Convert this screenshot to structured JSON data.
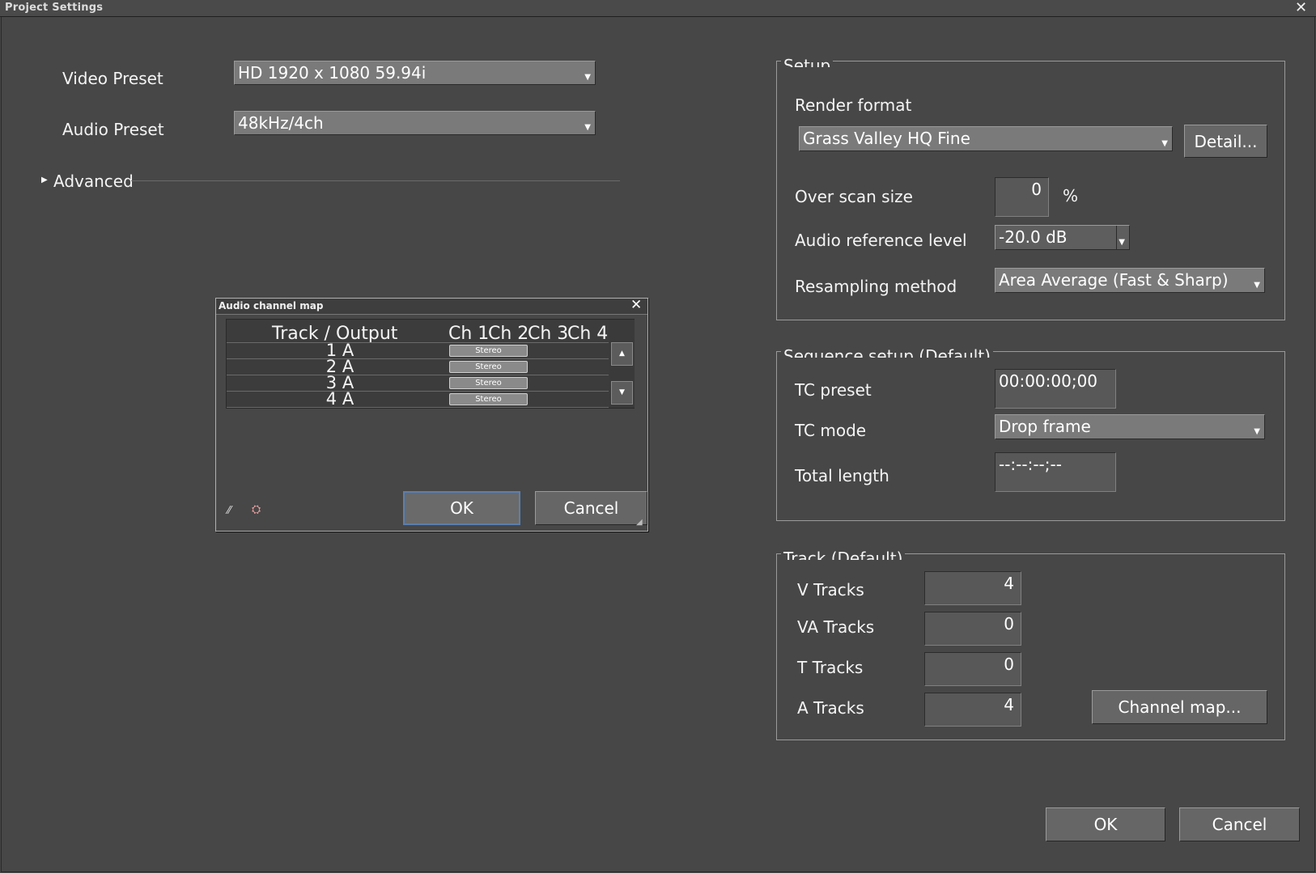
{
  "window": {
    "title": "Project Settings",
    "close_glyph": "✕"
  },
  "left": {
    "video_preset_label": "Video Preset",
    "video_preset_value": "HD 1920 x 1080 59.94i",
    "audio_preset_label": "Audio Preset",
    "audio_preset_value": "48kHz/4ch",
    "advanced_label": "Advanced"
  },
  "setup": {
    "title": "Setup",
    "render_format_label": "Render format",
    "render_format_value": "Grass Valley HQ Fine",
    "detail_button": "Detail...",
    "overscan_label": "Over scan size",
    "overscan_value": "0",
    "overscan_unit": "%",
    "audio_ref_label": "Audio reference level",
    "audio_ref_value": "-20.0 dB",
    "resampling_label": "Resampling method",
    "resampling_value": "Area Average (Fast & Sharp)"
  },
  "sequence": {
    "title": "Sequence setup (Default)",
    "tc_preset_label": "TC preset",
    "tc_preset_value": "00:00:00;00",
    "tc_mode_label": "TC mode",
    "tc_mode_value": "Drop frame",
    "total_length_label": "Total length",
    "total_length_value": "--:--:--;--"
  },
  "track": {
    "title": "Track (Default)",
    "v_label": "V Tracks",
    "v_value": "4",
    "va_label": "VA Tracks",
    "va_value": "0",
    "t_label": "T Tracks",
    "t_value": "0",
    "a_label": "A Tracks",
    "a_value": "4",
    "channel_map_button": "Channel map..."
  },
  "footer": {
    "ok": "OK",
    "cancel": "Cancel"
  },
  "channel_map_dialog": {
    "title": "Audio channel map",
    "close_glyph": "✕",
    "header_track": "Track / Output",
    "header_ch1": "Ch 1",
    "header_ch2": "Ch 2",
    "header_ch3": "Ch 3",
    "header_ch4": "Ch 4",
    "rows": [
      {
        "track": "1 A",
        "ch1": "Stereo"
      },
      {
        "track": "2 A",
        "ch1": "Stereo"
      },
      {
        "track": "3 A",
        "ch1": "Stereo"
      },
      {
        "track": "4 A",
        "ch1": "Stereo"
      }
    ],
    "ok": "OK",
    "cancel": "Cancel"
  },
  "colors": {
    "background": "#474747",
    "field": "#7a7a7a",
    "button": "#666666",
    "ok_focus_border": "#5a7fb0"
  }
}
